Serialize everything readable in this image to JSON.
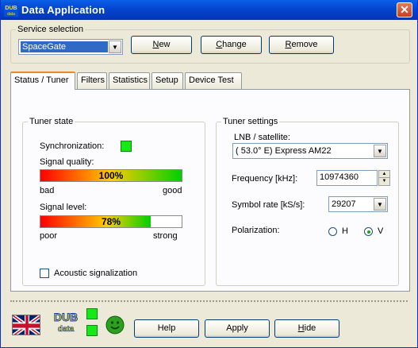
{
  "window": {
    "title": "Data Application",
    "logo_text": "DUB",
    "logo_subtext": "data",
    "close_symbol": "✕"
  },
  "service": {
    "group_label": "Service selection",
    "selected": "SpaceGate",
    "new_prefix": "",
    "new_underline": "N",
    "new_suffix": "ew",
    "change_prefix": "",
    "change_underline": "C",
    "change_suffix": "hange",
    "remove_prefix": "",
    "remove_underline": "R",
    "remove_suffix": "emove"
  },
  "tabs": [
    "Status / Tuner",
    "Filters",
    "Statistics",
    "Setup",
    "Device Test"
  ],
  "active_tab": "Status / Tuner",
  "tuner_state": {
    "group_label": "Tuner state",
    "sync_label": "Synchronization:",
    "sync_status_color": "#17e817",
    "quality_label": "Signal quality:",
    "quality_value": 100,
    "quality_text": "100%",
    "quality_min": "bad",
    "quality_max": "good",
    "level_label": "Signal level:",
    "level_value": 78,
    "level_text": "78%",
    "level_min": "poor",
    "level_max": "strong",
    "acoustic_label": "Acoustic signalization",
    "acoustic_checked": false
  },
  "tuner_settings": {
    "group_label": "Tuner settings",
    "lnb_label": "LNB / satellite:",
    "lnb_value": "(  53.0° E) Express AM22",
    "frequency_label": "Frequency [kHz]:",
    "frequency_value": "10974360",
    "symbol_label": "Symbol rate [kS/s]:",
    "symbol_value": "29207",
    "polarization_label": "Polarization:",
    "pol_h": "H",
    "pol_v": "V",
    "polarization_selected": "V"
  },
  "footer": {
    "help_label": "Help",
    "apply_label": "Apply",
    "hide_prefix": "",
    "hide_underline": "H",
    "hide_suffix": "ide",
    "status_color": "#17e817",
    "smiley": "☺"
  }
}
